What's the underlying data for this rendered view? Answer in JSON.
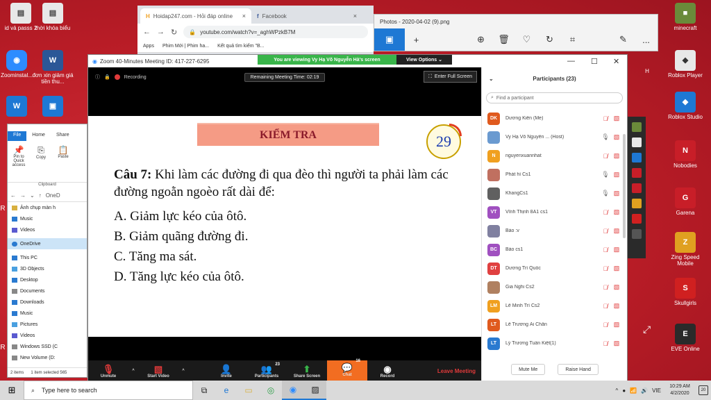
{
  "desktop": {
    "left_icons": [
      {
        "label": "id vả passs 2",
        "color": "#e8e8e8",
        "glyph": "▤"
      },
      {
        "label": "thời khóa biểu",
        "color": "#e8e8e8",
        "glyph": "▤"
      },
      {
        "label": "Zoominstal...",
        "color": "#2d8cff",
        "glyph": "◉"
      },
      {
        "label": "đơn xin giảm giá tiền thu...",
        "color": "#2b5797",
        "glyph": "W"
      },
      {
        "label": "",
        "color": "#1e78d4",
        "glyph": "W"
      },
      {
        "label": "",
        "color": "#1e78d4",
        "glyph": "▣"
      }
    ],
    "right_icons": [
      {
        "label": "minecraft",
        "color": "#6a8a3a",
        "glyph": "■"
      },
      {
        "label": "Roblox Player",
        "color": "#e8e8e8",
        "glyph": "◆"
      },
      {
        "label": "Roblox Studio",
        "color": "#1e78d4",
        "glyph": "◆"
      },
      {
        "label": "Nobodies",
        "color": "#c81e28",
        "glyph": "N"
      },
      {
        "label": "Garena",
        "color": "#c81e28",
        "glyph": "G"
      },
      {
        "label": "Zing Speed Mobile",
        "color": "#e0a020",
        "glyph": "Z"
      },
      {
        "label": "Skullgirls",
        "color": "#d02020",
        "glyph": "S"
      },
      {
        "label": "EVE Online",
        "color": "#2a2a2a",
        "glyph": "E"
      }
    ],
    "left_edge_letter_1": "R",
    "left_edge_letter_2": "R",
    "right_edge_letter": "H"
  },
  "browser": {
    "tab1": "Hoidap247.com - Hỏi đáp online",
    "tab2": "Facebook",
    "url": "youtube.com/watch?v=_aghWPzkB7M",
    "bookmarks": [
      "Apps",
      "Phim Mới | Phim ha...",
      "Kết quả tìm kiếm \"B..."
    ]
  },
  "photos": {
    "title": "Photos - 2020-04-02 (9).png",
    "more": "..."
  },
  "zoom": {
    "title": "Zoom 40-Minutes Meeting ID: 417-227-6295",
    "banner": "You are viewing Vy Hạ Võ Nguyễn Hà's screen",
    "view_options": "View Options ⌄",
    "recording": "Recording",
    "timer": "Remaining Meeting Time: 02:19",
    "full_screen": "Enter Full Screen",
    "slide": {
      "heading": "KIỂM TRA",
      "countdown": "29",
      "question_label": "Câu 7:",
      "question_text": " Khi làm các đường đi qua đèo thì người ta phải làm các đường ngoằn ngoèo rất dài để:",
      "options": [
        "A. Giảm lực kéo của ôtô.",
        "B. Giảm quãng đường đi.",
        "C. Tăng ma sát.",
        "D. Tăng lực kéo của ôtô."
      ]
    },
    "toolbar": {
      "unmute": "Unmute",
      "start_video": "Start Video",
      "invite": "Invite",
      "participants": "Participants",
      "participants_count": "23",
      "share": "Share Screen",
      "chat": "Chat",
      "chat_count": "16",
      "record": "Record",
      "leave": "Leave Meeting"
    },
    "panel": {
      "title": "Participants (23)",
      "search_placeholder": "Find a participant",
      "mute_me": "Mute Me",
      "raise_hand": "Raise Hand",
      "participants": [
        {
          "initials": "DK",
          "name": "Dương Kiên (Me)",
          "color": "#e05a1e",
          "mic": "muted"
        },
        {
          "initials": "",
          "name": "Vy Hạ Võ Nguyễn ... (Host)",
          "color": "#6a9ad0",
          "mic": "on"
        },
        {
          "initials": "N",
          "name": "nguyenxuannhat",
          "color": "#f0a020",
          "mic": "muted"
        },
        {
          "initials": "",
          "name": "Phát hí Cs1",
          "color": "#c07060",
          "mic": "on"
        },
        {
          "initials": "",
          "name": "KhangCs1",
          "color": "#606060",
          "mic": "on"
        },
        {
          "initials": "VT",
          "name": "Vĩnh Thịnh 8A1 cs1",
          "color": "#a050c0",
          "mic": "muted"
        },
        {
          "initials": "",
          "name": "Bảo :v",
          "color": "#8080a0",
          "mic": "muted"
        },
        {
          "initials": "BC",
          "name": "Bảo cs1",
          "color": "#a050c0",
          "mic": "muted"
        },
        {
          "initials": "DT",
          "name": "Dương Trí Quốc",
          "color": "#e04040",
          "mic": "muted"
        },
        {
          "initials": "",
          "name": "Gia Nghi Cs2",
          "color": "#b08060",
          "mic": "muted"
        },
        {
          "initials": "LM",
          "name": "Lê Minh Trí Cs2",
          "color": "#f0a020",
          "mic": "muted"
        },
        {
          "initials": "LT",
          "name": "Lê Trương Ái Chân",
          "color": "#e05a1e",
          "mic": "muted"
        },
        {
          "initials": "LT",
          "name": "Lý Trương Tuấn Kiệt(1)",
          "color": "#2a7ad0",
          "mic": "muted"
        }
      ]
    }
  },
  "explorer": {
    "tabs": [
      "File",
      "Home",
      "Share"
    ],
    "ribbon": [
      "Pin to Quick access",
      "Copy",
      "Paste"
    ],
    "clipboard": "Clipboard",
    "nav": "OneD",
    "tree": [
      {
        "label": "Ảnh chụp màn h",
        "color": "#d8b040"
      },
      {
        "label": "Music",
        "color": "#2a7ad0"
      },
      {
        "label": "Videos",
        "color": "#5a5ad0"
      },
      {
        "label": "OneDrive",
        "color": "#2a7ad0"
      },
      {
        "label": "This PC",
        "color": "#2a7ad0"
      },
      {
        "label": "3D Objects",
        "color": "#4aa0e0"
      },
      {
        "label": "Desktop",
        "color": "#2a7ad0"
      },
      {
        "label": "Documents",
        "color": "#888"
      },
      {
        "label": "Downloads",
        "color": "#2a7ad0"
      },
      {
        "label": "Music",
        "color": "#2a7ad0"
      },
      {
        "label": "Pictures",
        "color": "#4aa0e0"
      },
      {
        "label": "Videos",
        "color": "#5a5ad0"
      },
      {
        "label": "Windows SSD (C",
        "color": "#888"
      },
      {
        "label": "New Volume (D:",
        "color": "#888"
      }
    ],
    "status_items": "2 items",
    "status_selected": "1 item selected 565"
  },
  "taskbar": {
    "search_placeholder": "Type here to search",
    "language": "VIE",
    "time": "10:29 AM",
    "date": "4/2/2020",
    "notifications": "20"
  }
}
